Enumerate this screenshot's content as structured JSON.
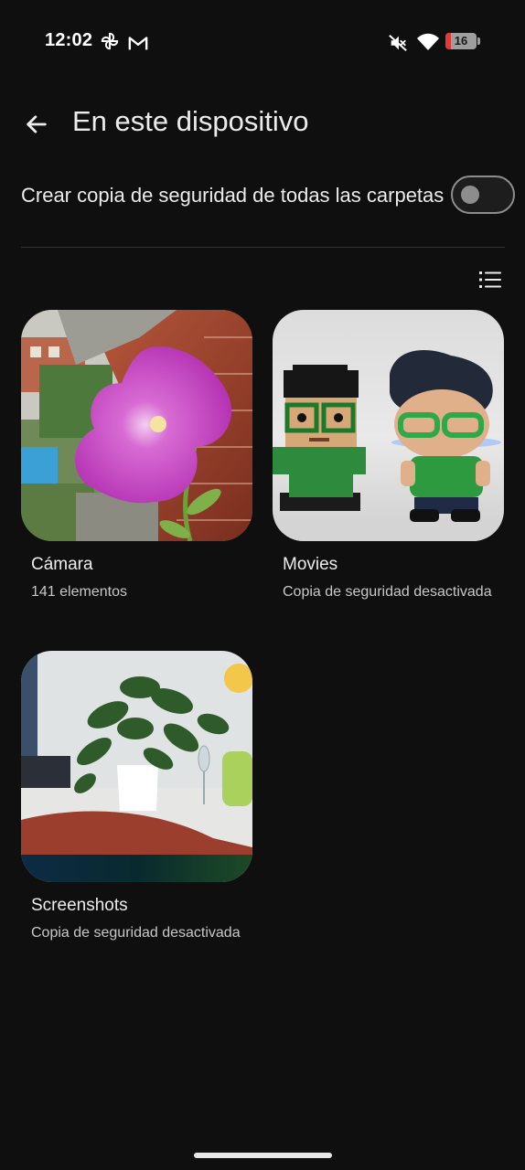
{
  "status_bar": {
    "time": "12:02",
    "app_icons": [
      "pinwheel-icon",
      "gmail-icon"
    ],
    "system_icons": [
      "mute-icon",
      "wifi-icon",
      "battery-icon"
    ],
    "battery_level": "16",
    "battery_color": "#e53935"
  },
  "app_bar": {
    "back_icon": "arrow-left-icon",
    "title": "En este dispositivo"
  },
  "backup_all": {
    "label": "Crear copia de seguridad de todas las carpetas",
    "enabled": false
  },
  "view_toggle_icon": "list-view-icon",
  "folders": [
    {
      "name": "Cámara",
      "subtitle": "141 elementos"
    },
    {
      "name": "Movies",
      "subtitle": "Copia de seguridad desactivada"
    },
    {
      "name": "Screenshots",
      "subtitle": "Copia de seguridad desactivada"
    }
  ],
  "colors": {
    "background": "#0f0f0f",
    "text_primary": "#ececec",
    "text_secondary": "#c8c8c8",
    "toggle_off": "#8d8d8d"
  }
}
